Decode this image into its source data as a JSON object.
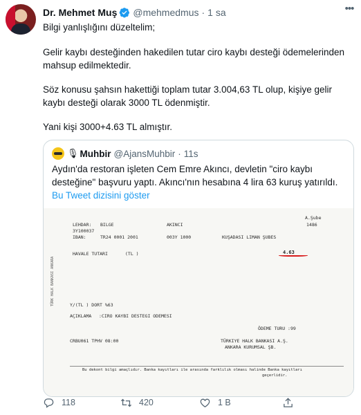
{
  "tweet": {
    "name": "Dr. Mehmet Muş",
    "handle": "@mehmedmus",
    "separator": "·",
    "time": "1 sa",
    "paragraphs": [
      "Bilgi yanlışlığını düzeltelim;",
      "Gelir kaybı desteğinden hakedilen tutar ciro kaybı desteği ödemelerinden mahsup edilmektedir.",
      "Söz konusu şahsın hakettiği toplam tutar 3.004,63 TL olup, kişiye gelir kaybı desteği olarak 3000 TL ödenmiştir.",
      "Yani kişi 3000+4.63 TL almıştır."
    ],
    "colors": {
      "verified": "#1d9bf0",
      "link": "#1d9bf0",
      "muted": "#536471",
      "highlight": "#d81b1b"
    }
  },
  "quote": {
    "name": "Muhbir",
    "mic_icon": "microphone-icon",
    "handle": "@AjansMuhbir",
    "separator": "·",
    "time": "11s",
    "text": "Aydın'da restoran işleten Cem Emre Akıncı,  devletin \"ciro kaybı desteğine\" başvuru yaptı. Akıncı'nın hesabına 4 lira 63 kuruş yatırıldı.",
    "thread_link": "Bu Tweet dizisini göster",
    "document": {
      "lehdar_label": "LEHDAR:",
      "lehdar_first": "BILGE",
      "lehdar_last": "AKINCI",
      "branch": "A.Şube",
      "branch_no": "1486",
      "account": "3Y100037",
      "iban_label": "IBAN:",
      "iban": "TR24 0001 2001",
      "iban_cont": "003Y 1000",
      "branch_name": "KUŞADASI LIMAN ŞUBES",
      "transfer_label": "HAVALE TUTARI",
      "transfer_unit": "(TL )",
      "amount": "4.63",
      "in_words": "Y/(TL ) DORT %63",
      "desc_label": "AÇIKLAMA",
      "desc": ":CIRO KAYBI DESTEGI ODEMESI",
      "payment_type": "ÖDEME TURU :99",
      "ref": "CRBU061 TPHV 08:00",
      "bank": "TÜRKIYE HALK BANKASI A.Ş.",
      "bank_branch": "ANKARA KURUMSAL ŞB.",
      "side_text": "TÜRK HALK BANKASI ANKARA",
      "footer": "Bu dekont bilgi amaçlıdır. Banka kayıtları ile arasında farklılık olması halinde Banka kayıtları",
      "footer2": "geçerlidir."
    }
  },
  "actions": {
    "reply_icon": "reply-icon",
    "replies": "118",
    "retweet_icon": "retweet-icon",
    "retweets": "420",
    "like_icon": "heart-icon",
    "likes": "1 B",
    "share_icon": "share-icon"
  }
}
